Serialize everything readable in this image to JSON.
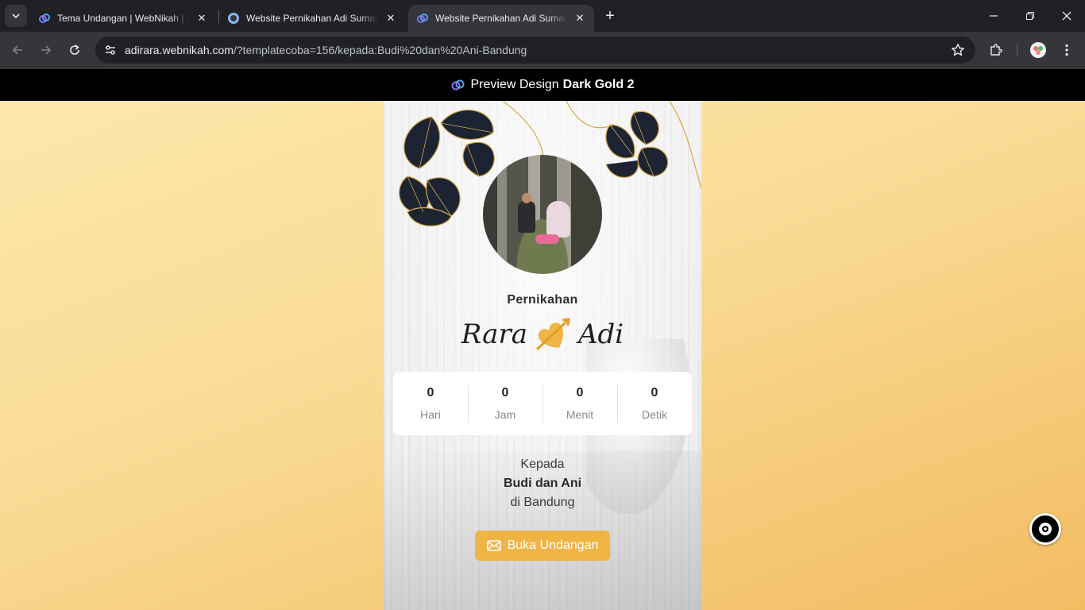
{
  "browser": {
    "tabs": [
      {
        "title": "Tema Undangan | WebNikah | Buat Undangan",
        "active": false
      },
      {
        "title": "Website Pernikahan Adi Sumaryadi",
        "active": false
      },
      {
        "title": "Website Pernikahan Adi Sumaryadi",
        "active": true
      }
    ],
    "close_glyph": "✕",
    "new_tab_glyph": "+",
    "url_host": "adirara.webnikah.com",
    "url_rest": "/?templatecoba=156/kepada:Budi%20dan%20Ani-Bandung"
  },
  "preview": {
    "label": "Preview Design",
    "design_name": "Dark Gold 2"
  },
  "invitation": {
    "subtitle": "Pernikahan",
    "bride": "Rara",
    "groom": "Adi",
    "countdown": [
      {
        "value": "0",
        "label": "Hari"
      },
      {
        "value": "0",
        "label": "Jam"
      },
      {
        "value": "0",
        "label": "Menit"
      },
      {
        "value": "0",
        "label": "Detik"
      }
    ],
    "to_label": "Kepada",
    "guest_name": "Budi dan Ani",
    "guest_location": "di Bandung",
    "open_button": "Buka Undangan"
  },
  "colors": {
    "accent": "#f0b445",
    "page_gradient_top": "#fde8ad",
    "page_gradient_bottom": "#f2bc62"
  }
}
